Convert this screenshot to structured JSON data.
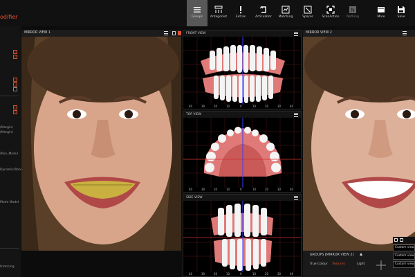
{
  "app": {
    "title_fragment": "odifier",
    "accent": "#e2532f"
  },
  "toolbar": {
    "tools": [
      {
        "label": "Groups",
        "icon": "list-icon",
        "active": true
      },
      {
        "label": "Antagonist",
        "icon": "antagonist-icon"
      },
      {
        "label": "Extras",
        "icon": "exclamation-icon"
      },
      {
        "label": "Articulator",
        "icon": "articulator-icon"
      },
      {
        "label": "Matching",
        "icon": "matching-icon"
      },
      {
        "label": "Spacer",
        "icon": "spacer-icon"
      },
      {
        "label": "ScanAction",
        "icon": "scan-icon"
      },
      {
        "label": "Nothing",
        "icon": "n-icon",
        "disabled": true
      },
      {
        "label": "More",
        "icon": "more-icon"
      },
      {
        "label": "Save",
        "icon": "save-icon"
      }
    ]
  },
  "left_strip": {
    "items": [
      "(Margin)",
      "(Margin)",
      "(Ron_Modul",
      "Dynamic/Rohe/Zalloes",
      "Mode Model",
      "trimming"
    ]
  },
  "mirror_view_1": {
    "title": "MIRROR VIEW 1"
  },
  "mirror_view_2": {
    "title": "MIRROR VIEW 2"
  },
  "front_view": {
    "title": "FRONT VIEW",
    "ticks": [
      "40",
      "30",
      "20",
      "10",
      "0",
      "10",
      "20",
      "30",
      "40"
    ]
  },
  "top_view": {
    "title": "TOP VIEW",
    "ticks": [
      "40",
      "30",
      "20",
      "10",
      "0",
      "10",
      "20",
      "30",
      "40"
    ]
  },
  "side_view": {
    "title": "SIDE VIEW",
    "ticks": [
      "40",
      "30",
      "20",
      "10",
      "0",
      "10",
      "20",
      "30",
      "40"
    ]
  },
  "groups_panel": {
    "title": "GROUPS [MIRROR VIEW 2]",
    "tabs": [
      "True Colour",
      "Textures",
      "Light"
    ],
    "active_tab": "Textures",
    "custom_views": [
      "Custom view",
      "Custom view",
      "Custom view"
    ]
  }
}
